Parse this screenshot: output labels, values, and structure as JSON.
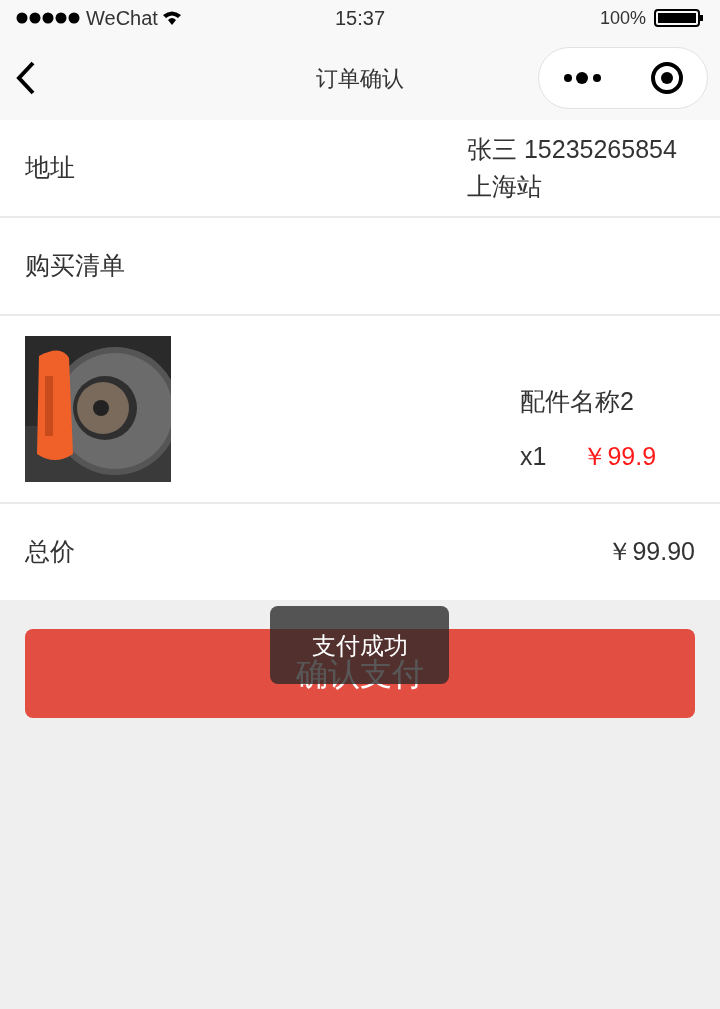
{
  "status_bar": {
    "carrier": "WeChat",
    "time": "15:37",
    "battery": "100%"
  },
  "nav": {
    "title": "订单确认"
  },
  "address": {
    "label": "地址",
    "name_phone": "张三 15235265854",
    "station": "上海站"
  },
  "list_header": "购买清单",
  "items": [
    {
      "kind": "picture",
      "name": "配件名称2",
      "quantity": "x1",
      "price": "￥99.9"
    }
  ],
  "total": {
    "label": "总价",
    "value": "￥99.90"
  },
  "pay_button": "确认支付",
  "toast": "支付成功"
}
